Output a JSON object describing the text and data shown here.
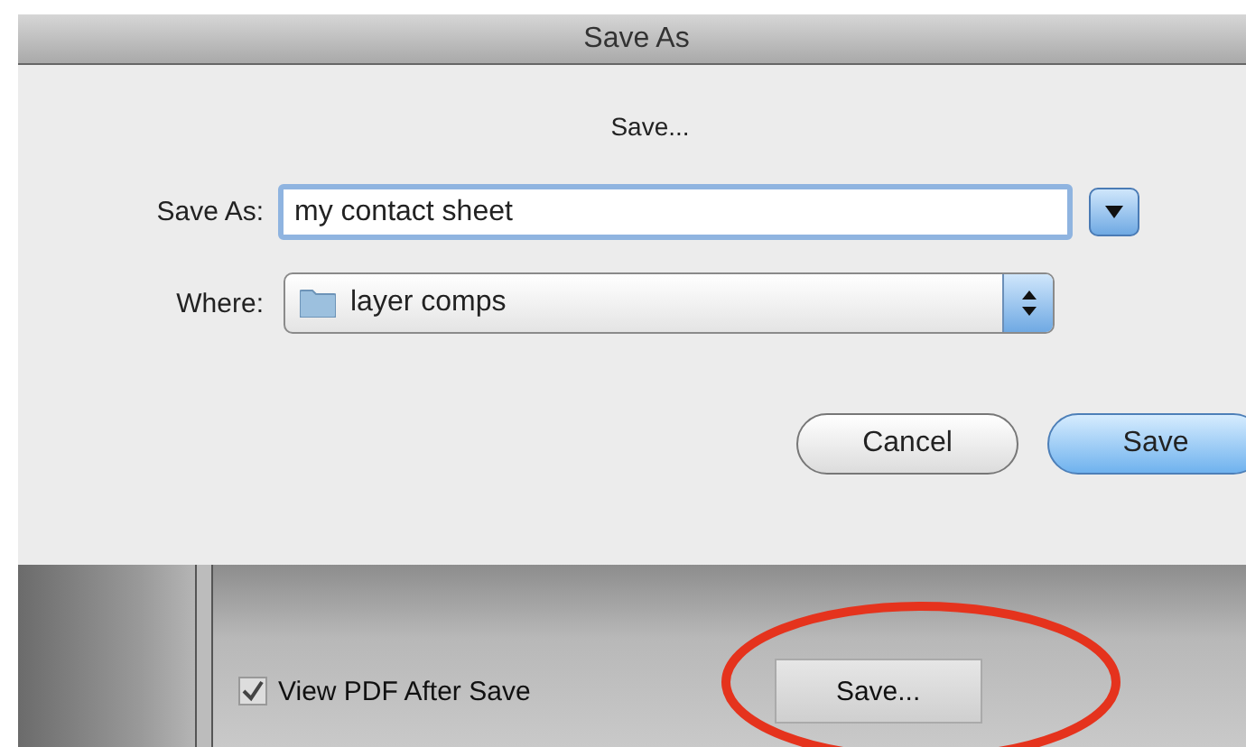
{
  "window": {
    "title": "Save As"
  },
  "dialog": {
    "heading": "Save...",
    "save_as": {
      "label": "Save As:",
      "value": "my contact sheet"
    },
    "where": {
      "label": "Where:",
      "value": "layer comps"
    },
    "buttons": [
      {
        "label": "Cancel",
        "default": false
      },
      {
        "label": "Save",
        "default": true
      }
    ]
  },
  "panel": {
    "view_pdf": {
      "label": "View PDF After Save",
      "checked": true
    },
    "save_button": {
      "label": "Save..."
    }
  }
}
